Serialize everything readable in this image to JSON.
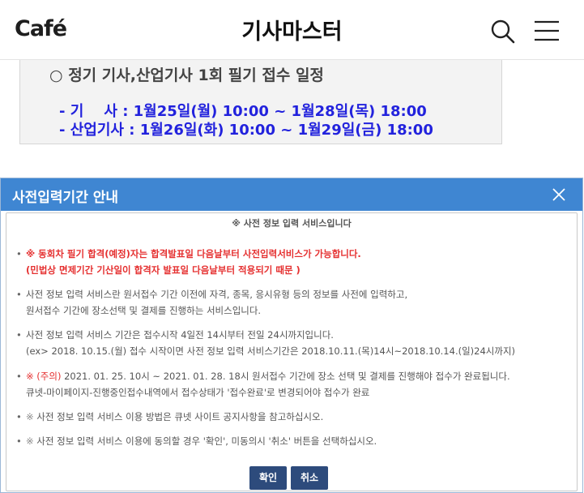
{
  "header": {
    "logo": "Café",
    "title": "기사마스터"
  },
  "article": {
    "heading": "○ 정기 기사,산업기사 1회 필기 접수 일정",
    "line1": "- 기    사 : 1월25일(월) 10:00 ~ 1월28일(목) 18:00",
    "line2": "- 산업기사 : 1월26일(화) 10:00 ~ 1월29일(금) 18:00"
  },
  "dialog": {
    "title": "사전입력기간 안내",
    "subtitle": "※ 사전 정보 입력 서비스입니다",
    "bullets": [
      {
        "line1": "※ 동회차 필기 합격(예정)자는 합격발표일 다음날부터 사전입력서비스가 가능합니다.",
        "line2": "(민법상 면제기간 기산일이 합격자 발표일 다음날부터 적용되기 때문 )"
      },
      {
        "line1": "사전 정보 입력 서비스란 원서접수 기간 이전에 자격, 종목, 응시유형 등의 정보를 사전에 입력하고,",
        "line2": "원서접수 기간에 장소선택 및 결제를 진행하는 서비스입니다."
      },
      {
        "line1": "사전 정보 입력 서비스 기간은 접수시작 4일전 14시부터 전일 24시까지입니다.",
        "line2": "(ex> 2018. 10.15.(월) 접수 시작이면 사전 정보 입력 서비스기간은 2018.10.11.(목)14시~2018.10.14.(일)24시까지)"
      },
      {
        "note_mark": "※ (주의)",
        "line1": " 2021. 01. 25. 10시 ~ 2021. 01. 28. 18시 원서접수 기간에 장소 선택 및 결제를 진행해야 접수가 완료됩니다.",
        "line2": "큐넷-마이페이지-진행중인접수내역에서 접수상태가 '접수완료'로 변경되어야 접수가 완료"
      },
      {
        "mark": "※",
        "line1": " 사전 정보 입력 서비스 이용 방법은 큐넷 사이트 공지사항을 참고하십시오."
      },
      {
        "mark": "※",
        "line1": " 사전 정보 입력 서비스 이용에 동의할 경우 '확인', 미동의시 '취소' 버튼을 선택하십시오."
      }
    ],
    "ok_label": "확인",
    "cancel_label": "취소"
  },
  "icons": {
    "search": "search-icon",
    "menu": "hamburger-menu-icon",
    "close": "close-icon"
  },
  "colors": {
    "dialog_header": "#3f86d2",
    "button": "#2d4b7c",
    "warning": "#e53030",
    "article_text": "#2222dd"
  }
}
